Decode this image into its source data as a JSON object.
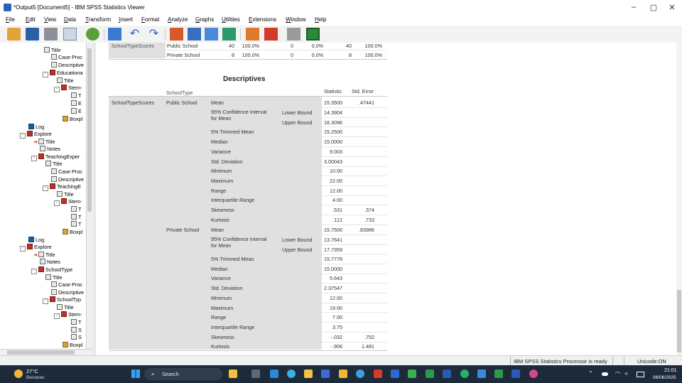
{
  "window": {
    "title": "*Output5 [Document5] - IBM SPSS Statistics Viewer",
    "min": "–",
    "max": "▢",
    "close": "✕"
  },
  "menu": [
    "File",
    "Edit",
    "View",
    "Data",
    "Transform",
    "Insert",
    "Format",
    "Analyze",
    "Graphs",
    "Utilities",
    "Extensions",
    "Window",
    "Help"
  ],
  "tree": {
    "items": [
      {
        "text": "Title",
        "icon": "note"
      },
      {
        "text": "Case Proc",
        "icon": "note"
      },
      {
        "text": "Descriptive",
        "icon": "note"
      },
      {
        "text": "Educationa",
        "icon": "book"
      },
      {
        "text": "Title",
        "icon": "note"
      },
      {
        "text": "Stem-",
        "icon": "book"
      },
      {
        "text": "T",
        "icon": "note"
      },
      {
        "text": "E",
        "icon": "note"
      },
      {
        "text": "E",
        "icon": "note"
      },
      {
        "text": "Boxpl",
        "icon": "chart"
      },
      {
        "text": "Log",
        "icon": "log"
      },
      {
        "text": "Explore",
        "icon": "book"
      },
      {
        "text": "Title",
        "icon": "note"
      },
      {
        "text": "Notes",
        "icon": "note"
      },
      {
        "text": "TeachingExper",
        "icon": "book"
      },
      {
        "text": "Title",
        "icon": "note"
      },
      {
        "text": "Case Proc",
        "icon": "note"
      },
      {
        "text": "Descriptive",
        "icon": "note"
      },
      {
        "text": "TeachingE",
        "icon": "book"
      },
      {
        "text": "Title",
        "icon": "note"
      },
      {
        "text": "Stem-",
        "icon": "book"
      },
      {
        "text": "T",
        "icon": "note"
      },
      {
        "text": "T",
        "icon": "note"
      },
      {
        "text": "T",
        "icon": "note"
      },
      {
        "text": "Boxpl",
        "icon": "chart"
      },
      {
        "text": "Log",
        "icon": "log"
      },
      {
        "text": "Explore",
        "icon": "book"
      },
      {
        "text": "Title",
        "icon": "note"
      },
      {
        "text": "Notes",
        "icon": "note"
      },
      {
        "text": "SchoolType",
        "icon": "book"
      },
      {
        "text": "Title",
        "icon": "note"
      },
      {
        "text": "Case Proc",
        "icon": "note"
      },
      {
        "text": "Descriptive",
        "icon": "note"
      },
      {
        "text": "SchoolTyp",
        "icon": "book"
      },
      {
        "text": "Title",
        "icon": "note"
      },
      {
        "text": "Stem-",
        "icon": "book"
      },
      {
        "text": "T",
        "icon": "note"
      },
      {
        "text": "S",
        "icon": "note"
      },
      {
        "text": "S",
        "icon": "note"
      },
      {
        "text": "Boxpl",
        "icon": "chart"
      }
    ]
  },
  "prev_table": {
    "row1": [
      "SchoolTypeScores",
      "Public School",
      "40",
      "100.0%",
      "0",
      "0.0%",
      "40",
      "100.0%"
    ],
    "row2": [
      "Private School",
      "8",
      "100.0%",
      "0",
      "0.0%",
      "8",
      "100.0%"
    ]
  },
  "descriptives": {
    "title": "Descriptives",
    "col_header_label": "SchoolType",
    "col_statistic": "Statistic",
    "col_std_error": "Std. Error",
    "dependent": "SchoolTypeScores",
    "groups": [
      {
        "name": "Public School",
        "rows": [
          {
            "label": "Mean",
            "sub": "",
            "stat": "15.3500",
            "se": ".47441"
          },
          {
            "label": "95% Confidence Interval",
            "label2": "for Mean",
            "sub": "Lower Bound",
            "stat": "14.3904",
            "se": ""
          },
          {
            "label": "",
            "sub": "Upper Bound",
            "stat": "16.3096",
            "se": ""
          },
          {
            "label": "5% Trimmed Mean",
            "sub": "",
            "stat": "15.2500",
            "se": ""
          },
          {
            "label": "Median",
            "sub": "",
            "stat": "15.0000",
            "se": ""
          },
          {
            "label": "Variance",
            "sub": "",
            "stat": "9.003",
            "se": ""
          },
          {
            "label": "Std. Deviation",
            "sub": "",
            "stat": "3.00043",
            "se": ""
          },
          {
            "label": "Minimum",
            "sub": "",
            "stat": "10.00",
            "se": ""
          },
          {
            "label": "Maximum",
            "sub": "",
            "stat": "22.00",
            "se": ""
          },
          {
            "label": "Range",
            "sub": "",
            "stat": "12.00",
            "se": ""
          },
          {
            "label": "Interquartile Range",
            "sub": "",
            "stat": "4.00",
            "se": ""
          },
          {
            "label": "Skewness",
            "sub": "",
            "stat": ".531",
            "se": ".374"
          },
          {
            "label": "Kurtosis",
            "sub": "",
            "stat": ".112",
            "se": ".733"
          }
        ]
      },
      {
        "name": "Private School",
        "rows": [
          {
            "label": "Mean",
            "sub": "",
            "stat": "15.7500",
            "se": ".83986"
          },
          {
            "label": "95% Confidence Interval",
            "label2": "for Mean",
            "sub": "Lower Bound",
            "stat": "13.7641",
            "se": ""
          },
          {
            "label": "",
            "sub": "Upper Bound",
            "stat": "17.7359",
            "se": ""
          },
          {
            "label": "5% Trimmed Mean",
            "sub": "",
            "stat": "15.7778",
            "se": ""
          },
          {
            "label": "Median",
            "sub": "",
            "stat": "15.0000",
            "se": ""
          },
          {
            "label": "Variance",
            "sub": "",
            "stat": "5.643",
            "se": ""
          },
          {
            "label": "Std. Deviation",
            "sub": "",
            "stat": "2.37547",
            "se": ""
          },
          {
            "label": "Minimum",
            "sub": "",
            "stat": "12.00",
            "se": ""
          },
          {
            "label": "Maximum",
            "sub": "",
            "stat": "19.00",
            "se": ""
          },
          {
            "label": "Range",
            "sub": "",
            "stat": "7.00",
            "se": ""
          },
          {
            "label": "Interquartile Range",
            "sub": "",
            "stat": "3.75",
            "se": ""
          },
          {
            "label": "Skewness",
            "sub": "",
            "stat": "-.032",
            "se": ".752"
          },
          {
            "label": "Kurtosis",
            "sub": "",
            "stat": "-.906",
            "se": "1.481"
          }
        ]
      }
    ]
  },
  "status": {
    "processor": "IBM SPSS Statistics Processor is ready",
    "unicode": "Unicode:ON"
  },
  "taskbar": {
    "temp": "27°C",
    "weather": "Berawan",
    "search_placeholder": "Search",
    "time": "21:01",
    "date": "06/06/2025"
  }
}
